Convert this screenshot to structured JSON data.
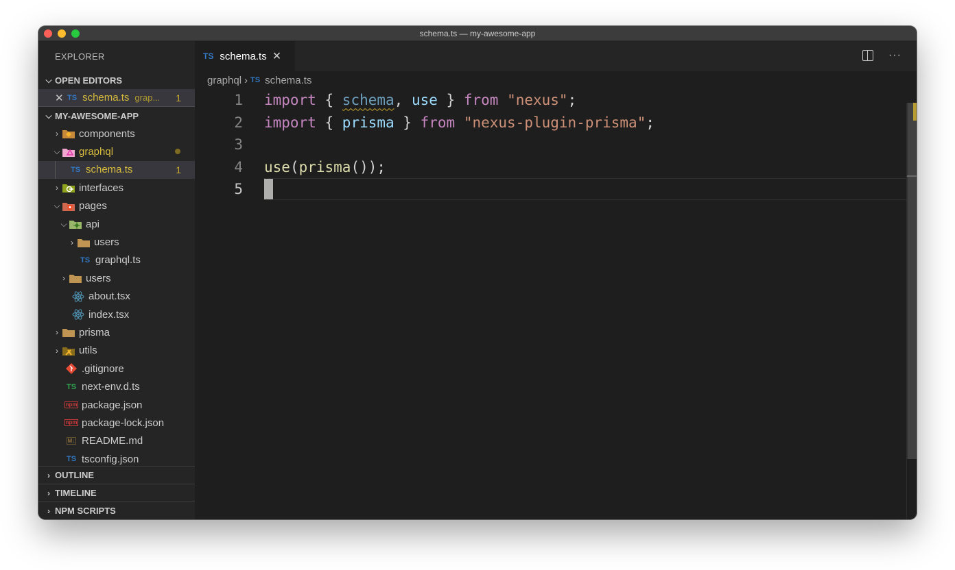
{
  "window": {
    "title": "schema.ts — my-awesome-app"
  },
  "sidebar": {
    "header": "EXPLORER",
    "open_editors": {
      "label": "OPEN EDITORS",
      "items": [
        {
          "icon": "typescript-icon",
          "icon_text": "TS",
          "name": "schema.ts",
          "dir": "grap...",
          "badge": "1"
        }
      ]
    },
    "project": {
      "label": "MY-AWESOME-APP",
      "items": [
        {
          "name": "components",
          "type": "folder",
          "expanded": false,
          "depth": 0
        },
        {
          "name": "graphql",
          "type": "folder",
          "expanded": true,
          "depth": 0,
          "modified": true
        },
        {
          "name": "schema.ts",
          "type": "file",
          "depth": 1,
          "icon_text": "TS",
          "modified": true,
          "selected": true,
          "badge": "1"
        },
        {
          "name": "interfaces",
          "type": "folder",
          "expanded": false,
          "depth": 0
        },
        {
          "name": "pages",
          "type": "folder",
          "expanded": true,
          "depth": 0
        },
        {
          "name": "api",
          "type": "folder",
          "expanded": true,
          "depth": 1
        },
        {
          "name": "users",
          "type": "folder",
          "expanded": false,
          "depth": 2
        },
        {
          "name": "graphql.ts",
          "type": "file",
          "depth": 2,
          "icon_text": "TS"
        },
        {
          "name": "users",
          "type": "folder",
          "expanded": false,
          "depth": 1
        },
        {
          "name": "about.tsx",
          "type": "file",
          "depth": 1
        },
        {
          "name": "index.tsx",
          "type": "file",
          "depth": 1
        },
        {
          "name": "prisma",
          "type": "folder",
          "expanded": false,
          "depth": 0
        },
        {
          "name": "utils",
          "type": "folder",
          "expanded": false,
          "depth": 0
        },
        {
          "name": ".gitignore",
          "type": "file",
          "depth": 0
        },
        {
          "name": "next-env.d.ts",
          "type": "file",
          "depth": 0,
          "icon_text": "TS"
        },
        {
          "name": "package.json",
          "type": "file",
          "depth": 0,
          "icon_text": "npm"
        },
        {
          "name": "package-lock.json",
          "type": "file",
          "depth": 0,
          "icon_text": "npm"
        },
        {
          "name": "README.md",
          "type": "file",
          "depth": 0,
          "icon_text": "M↓"
        },
        {
          "name": "tsconfig.json",
          "type": "file",
          "depth": 0,
          "icon_text": "TS"
        }
      ]
    },
    "bottom_sections": [
      "OUTLINE",
      "TIMELINE",
      "NPM SCRIPTS"
    ]
  },
  "editor": {
    "tab": {
      "icon_text": "TS",
      "name": "schema.ts",
      "close": "✕"
    },
    "actions": {
      "more": "···"
    },
    "breadcrumbs": {
      "folder": "graphql",
      "sep": "›",
      "icon_text": "TS",
      "file": "schema.ts"
    },
    "line_numbers": [
      "1",
      "2",
      "3",
      "4",
      "5"
    ],
    "code": {
      "l1": {
        "kw1": "import",
        "p1": " { ",
        "id1": "schema",
        "p2": ", ",
        "id2": "use",
        "p3": " } ",
        "kw2": "from",
        "p4": " ",
        "str": "\"nexus\"",
        "p5": ";"
      },
      "l2": {
        "kw1": "import",
        "p1": " { ",
        "id1": "prisma",
        "p2": " } ",
        "kw2": "from",
        "p3": " ",
        "str": "\"nexus-plugin-prisma\"",
        "p4": ";"
      },
      "l4": {
        "fn1": "use",
        "p1": "(",
        "fn2": "prisma",
        "p2": "());"
      }
    }
  }
}
